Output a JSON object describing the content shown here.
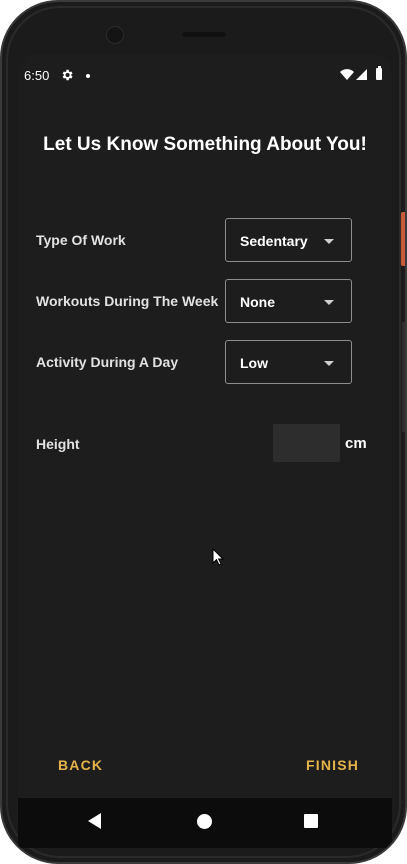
{
  "status_bar": {
    "time": "6:50",
    "icons": [
      "gear-icon",
      "dot-icon",
      "wifi-icon",
      "signal-icon",
      "battery-icon"
    ]
  },
  "page": {
    "title": "Let Us Know Something About You!"
  },
  "form": {
    "type_of_work": {
      "label": "Type Of Work",
      "value": "Sedentary"
    },
    "workouts": {
      "label": "Workouts During The Week",
      "value": "None"
    },
    "activity": {
      "label": "Activity During A Day",
      "value": "Low"
    },
    "height": {
      "label": "Height",
      "value": "",
      "unit": "cm"
    }
  },
  "footer": {
    "back_label": "BACK",
    "finish_label": "FINISH"
  },
  "colors": {
    "background": "#1d1d1d",
    "accent": "#e6b34a",
    "dropdown_border": "#8e8e8e",
    "input_fill": "#2d2d2d"
  }
}
